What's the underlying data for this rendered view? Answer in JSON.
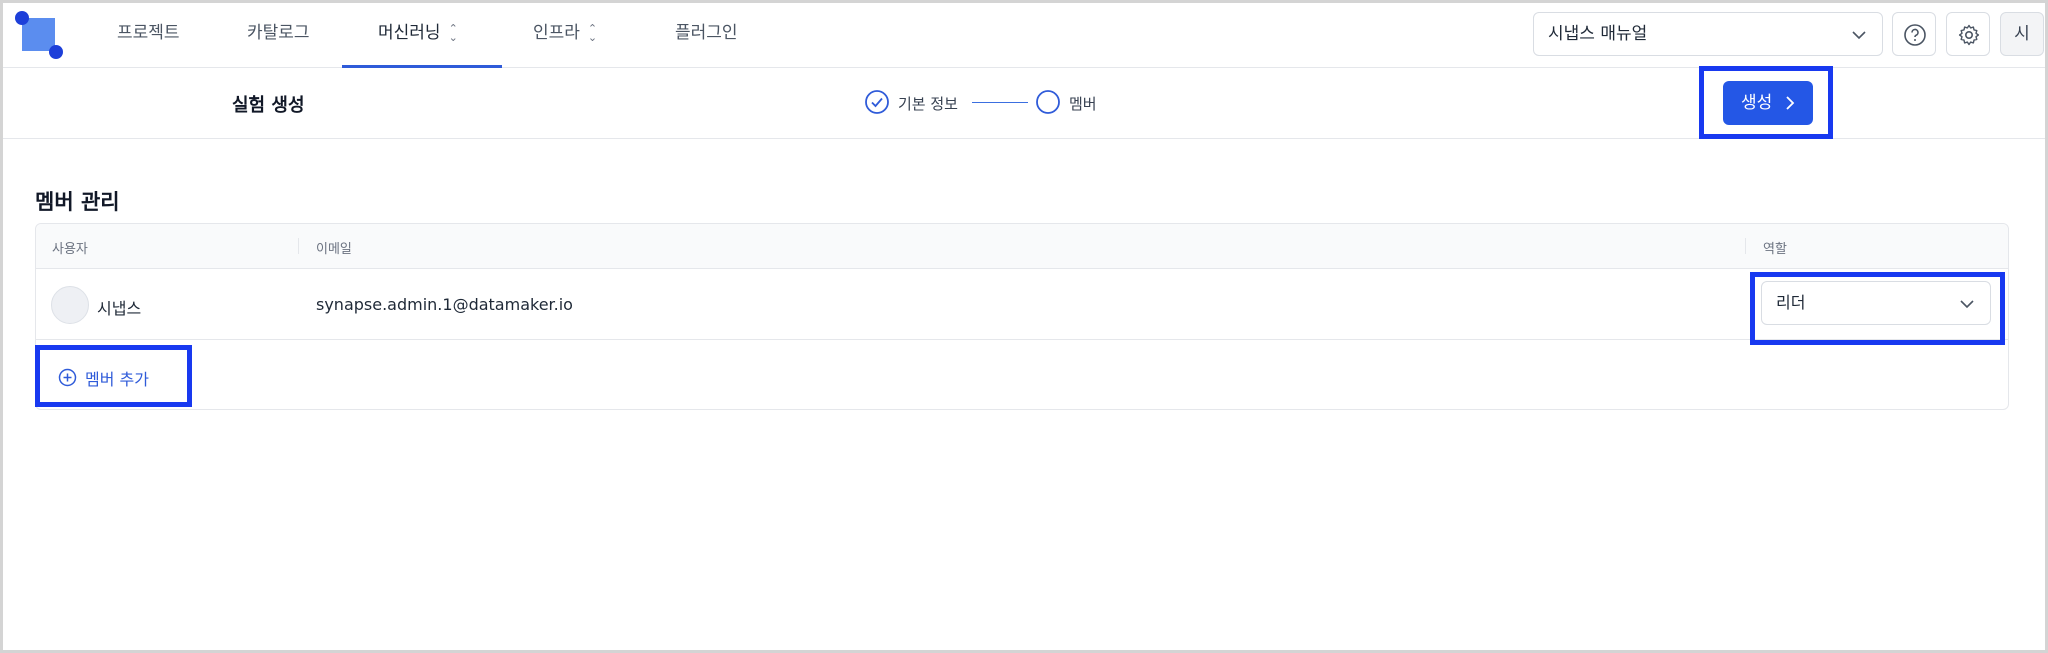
{
  "nav": {
    "items": [
      {
        "label": "프로젝트"
      },
      {
        "label": "카탈로그"
      },
      {
        "label": "머신러닝",
        "active": true
      },
      {
        "label": "인프라"
      },
      {
        "label": "플러그인"
      }
    ],
    "project_select": "시냅스 매뉴얼",
    "user_initial": "시",
    "icons": [
      "help-icon",
      "gear-icon"
    ]
  },
  "subheader": {
    "title": "실험 생성",
    "steps": [
      {
        "label": "기본 정보",
        "status": "done"
      },
      {
        "label": "멤버",
        "status": "current"
      }
    ],
    "create_label": "생성"
  },
  "members": {
    "title": "멤버 관리",
    "columns": [
      "사용자",
      "이메일",
      "역할"
    ],
    "rows": [
      {
        "name": "시냅스",
        "email": "synapse.admin.1@datamaker.io",
        "role": "리더"
      }
    ],
    "add_label": "멤버 추가"
  },
  "colors": {
    "accent": "#2457e6",
    "highlight_box": "#1839f0",
    "logo": "#5b8def"
  }
}
